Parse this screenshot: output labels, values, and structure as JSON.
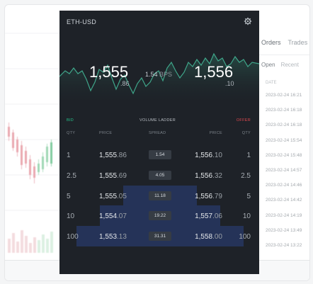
{
  "widget": {
    "title": "ETH-USD",
    "bid_price": {
      "main": "1,555",
      "tail": ".86"
    },
    "offer_price": {
      "main": "1,556",
      "tail": ".10"
    },
    "spread_bps": "1.54",
    "spread_unit": "BPS"
  },
  "ladder": {
    "bid_label": "BID",
    "title": "VOLUME LADDER",
    "offer_label": "OFFER",
    "headers": [
      "QTY",
      "PRICE",
      "SPREAD",
      "PRICE",
      "QTY"
    ],
    "rows": [
      {
        "qty": "1",
        "bid_main": "1,555",
        "bid_tail": ".86",
        "spread": "1.54",
        "offer_main": "1,556",
        "offer_tail": ".10",
        "offer_qty": "1",
        "depth": 0.0
      },
      {
        "qty": "2.5",
        "bid_main": "1,555",
        "bid_tail": ".69",
        "spread": "4.05",
        "offer_main": "1,556",
        "offer_tail": ".32",
        "offer_qty": "2.5",
        "depth": 0.0
      },
      {
        "qty": "5",
        "bid_main": "1,555",
        "bid_tail": ".05",
        "spread": "11.18",
        "offer_main": "1,556",
        "offer_tail": ".79",
        "offer_qty": "5",
        "depth": 0.33
      },
      {
        "qty": "10",
        "bid_main": "1,554",
        "bid_tail": ".07",
        "spread": "19.22",
        "offer_main": "1,557",
        "offer_tail": ".06",
        "offer_qty": "10",
        "depth": 0.66
      },
      {
        "qty": "100",
        "bid_main": "1,553",
        "bid_tail": ".13",
        "spread": "31.31",
        "offer_main": "1,558",
        "offer_tail": ".00",
        "offer_qty": "100",
        "depth": 1.0
      }
    ]
  },
  "right_panel": {
    "tabs": [
      "Orders",
      "Trades"
    ],
    "subtabs": [
      "Open",
      "Recent"
    ],
    "date_header": "DATE",
    "dates": [
      "2023-02-24 16:21",
      "2023-02-24 16:18",
      "2023-02-24 16:18",
      "2023-02-24 15:54",
      "2023-02-24 15:48",
      "2023-02-24 14:57",
      "2023-02-24 14:46",
      "2023-02-24 14:42",
      "2023-02-24 14:19",
      "2023-02-24 13:49",
      "2023-02-24 13:22"
    ]
  },
  "colors": {
    "bid": "#25c18a",
    "offer": "#e0484f",
    "depth": "#253358",
    "widget_bg": "#1e2228",
    "chart_line": "#3fa68a"
  }
}
